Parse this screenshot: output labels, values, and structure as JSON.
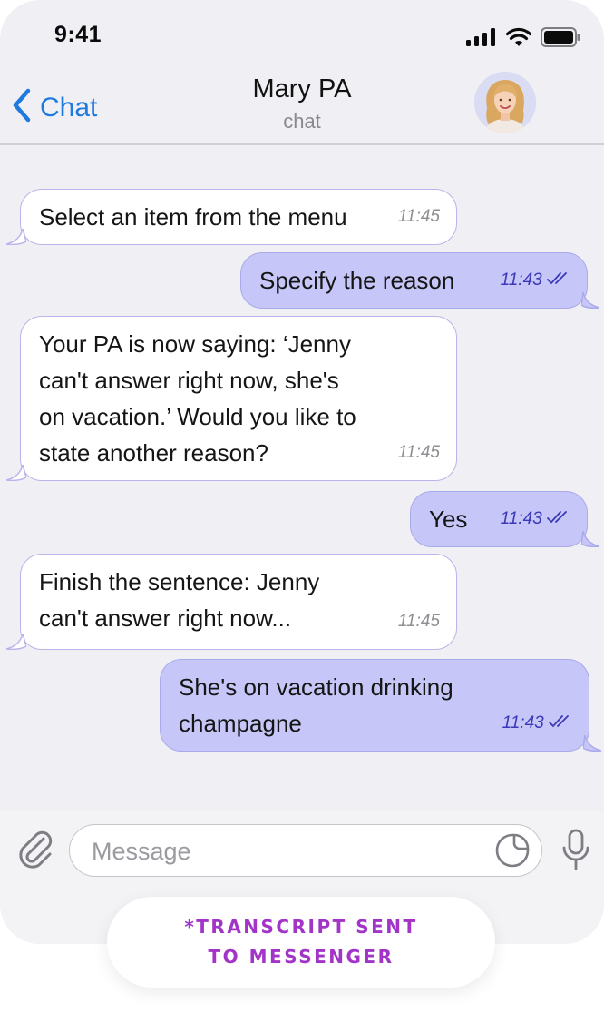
{
  "status_bar": {
    "time": "9:41",
    "icons": [
      "signal-icon",
      "wifi-icon",
      "battery-icon"
    ]
  },
  "header": {
    "back_label": "Chat",
    "title": "Mary PA",
    "subtitle": "chat",
    "avatar": "avatar-photo"
  },
  "messages": [
    {
      "direction": "in",
      "text": "Select an item from the menu",
      "time": "11:45"
    },
    {
      "direction": "out",
      "text": "Specify the reason",
      "time": "11:43",
      "status": "read"
    },
    {
      "direction": "in",
      "text": "Your PA is now saying: ‘Jenny\ncan't answer right now, she's\non vacation.’ Would you like to\nstate another reason?",
      "time": "11:45"
    },
    {
      "direction": "out",
      "text": "Yes",
      "time": "11:43",
      "status": "read"
    },
    {
      "direction": "in",
      "text": "Finish the sentence: Jenny\ncan't answer right now...",
      "time": "11:45"
    },
    {
      "direction": "out",
      "text": "She's on vacation drinking\nchampagne",
      "time": "11:43",
      "status": "read"
    }
  ],
  "composer": {
    "placeholder": "Message",
    "value": "",
    "icons": [
      "paperclip-icon",
      "sticker-icon",
      "microphone-icon"
    ]
  },
  "badge": {
    "line1": "*TRANSCRIPT SENT",
    "line2": "TO MESSENGER"
  },
  "colors": {
    "accent": "#1f7ae0",
    "outgoing_bubble": "#c6c6f8",
    "incoming_border": "#b9b4ea",
    "read_ticks": "#3b39b8",
    "badge_text": "#a235c8"
  }
}
